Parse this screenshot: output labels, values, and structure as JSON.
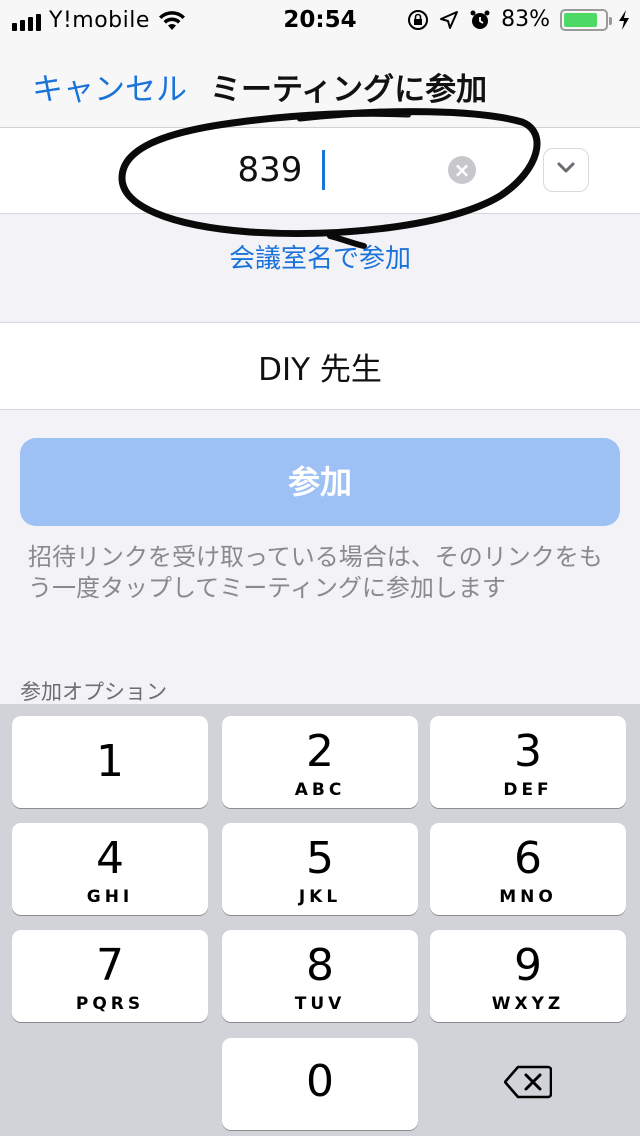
{
  "status_bar": {
    "carrier": "Y!mobile",
    "time": "20:54",
    "battery_percent": "83%",
    "battery_level": 0.83
  },
  "nav": {
    "cancel_label": "キャンセル",
    "title": "ミーティングに参加"
  },
  "meeting_id_input": {
    "value": "839"
  },
  "join_with_room_name_label": "会議室名で参加",
  "name_input": {
    "value": "DIY 先生"
  },
  "join_button_label": "参加",
  "hint_text": "招待リンクを受け取っている場合は、そのリンクをもう一度タップしてミーティングに参加します",
  "join_options_label": "参加オプション",
  "keypad": {
    "keys": [
      {
        "digit": "1",
        "letters": ""
      },
      {
        "digit": "2",
        "letters": "ABC"
      },
      {
        "digit": "3",
        "letters": "DEF"
      },
      {
        "digit": "4",
        "letters": "GHI"
      },
      {
        "digit": "5",
        "letters": "JKL"
      },
      {
        "digit": "6",
        "letters": "MNO"
      },
      {
        "digit": "7",
        "letters": "PQRS"
      },
      {
        "digit": "8",
        "letters": "TUV"
      },
      {
        "digit": "9",
        "letters": "WXYZ"
      },
      {
        "digit": "0",
        "letters": ""
      }
    ]
  },
  "colors": {
    "accent": "#1a73d9",
    "join_button_disabled": "#9dc0f5",
    "battery": "#4cd964",
    "keypad_bg": "#d1d3d8"
  },
  "icons": [
    "signal-bars-icon",
    "wifi-icon",
    "orientation-lock-icon",
    "location-arrow-icon",
    "alarm-icon",
    "battery-icon",
    "charging-bolt-icon",
    "clear-icon",
    "chevron-down-icon",
    "backspace-icon"
  ]
}
